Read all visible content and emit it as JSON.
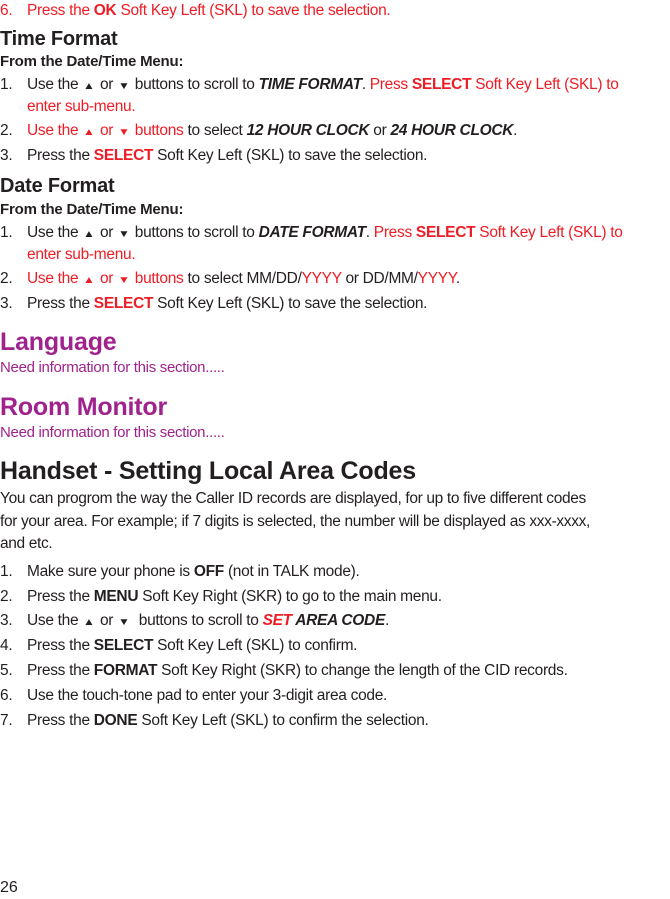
{
  "page_number": "26",
  "colors": {
    "accent_red": "#ee1c25",
    "heading_purple": "#a0228c",
    "text": "#231f20"
  },
  "icons": {
    "up": "▲",
    "down": "▼"
  },
  "top_step": {
    "num": "6.",
    "pre": "Press the ",
    "key": "OK",
    "post": " Soft Key Left (SKL) to save the selection."
  },
  "time_format": {
    "title": "Time Format",
    "subtitle": "From the Date/Time Menu:",
    "steps": [
      {
        "num": "1.",
        "a": "Use the ",
        "or": " or ",
        "b": " buttons to scroll to ",
        "target": "TIME FORMAT",
        "c": ". ",
        "d": "Press ",
        "key": "SELECT",
        "e": " Soft Key Left (SKL) to",
        "wrap": "enter sub-menu."
      },
      {
        "num": "2.",
        "a": "Use the ",
        "or": " or ",
        "b": " buttons",
        "c": " to select ",
        "opt1": "12 HOUR CLOCK",
        "mid": " or ",
        "opt2": "24 HOUR CLOCK",
        "end": "."
      },
      {
        "num": "3.",
        "a": "Press the ",
        "key": "SELECT",
        "b": " Soft Key Left (SKL) to save the selection."
      }
    ]
  },
  "date_format": {
    "title": "Date Format",
    "subtitle": "From the Date/Time Menu:",
    "steps": [
      {
        "num": "1.",
        "a": "Use the ",
        "or": " or ",
        "b": " buttons to scroll to ",
        "target": "DATE FORMAT",
        "c": ". ",
        "d": "Press ",
        "key": "SELECT",
        "e": " Soft Key Left (SKL) to",
        "wrap": "enter sub-menu."
      },
      {
        "num": "2.",
        "a": "Use the ",
        "or": " or ",
        "b": " buttons",
        "c": " to select MM/DD/",
        "y1": "YYYY",
        "mid": " or DD/MM/",
        "y2": "YYYY",
        "end": "."
      },
      {
        "num": "3.",
        "a": "Press the ",
        "key": "SELECT",
        "b": " Soft Key Left (SKL) to save the selection."
      }
    ]
  },
  "language": {
    "title": "Language",
    "note": "Need information for this section....."
  },
  "room_monitor": {
    "title": "Room Monitor",
    "note": "Need information for this section....."
  },
  "area_codes": {
    "title": "Handset - Setting Local Area Codes",
    "intro_lines": [
      "You can progrom the way the Caller ID records are displayed, for up to five different codes",
      "for your area. For example; if 7 digits is selected, the number will be displayed as xxx-xxxx,",
      "and etc."
    ],
    "steps": [
      {
        "num": "1.",
        "a": "Make sure your phone is ",
        "key": "OFF",
        "b": " (not in TALK mode)."
      },
      {
        "num": "2.",
        "a": "Press the ",
        "key": "MENU",
        "b": " Soft Key Right (SKR) to go to the main menu."
      },
      {
        "num": "3.",
        "a": "Use the ",
        "or": " or ",
        "b": "  buttons to scroll to ",
        "target_red": "SET",
        "target_rest": " AREA CODE",
        "end": "."
      },
      {
        "num": "4.",
        "a": "Press the ",
        "key": "SELECT",
        "b": " Soft Key Left (SKL) to confirm."
      },
      {
        "num": "5.",
        "a": "Press the ",
        "key": "FORMAT",
        "b": " Soft Key Right (SKR) to change the length of the CID records."
      },
      {
        "num": "6.",
        "a": "Use the touch-tone pad to enter your 3-digit area code."
      },
      {
        "num": "7.",
        "a": "Press the ",
        "key": "DONE",
        "b": " Soft Key Left (SKL) to confirm the selection."
      }
    ]
  }
}
